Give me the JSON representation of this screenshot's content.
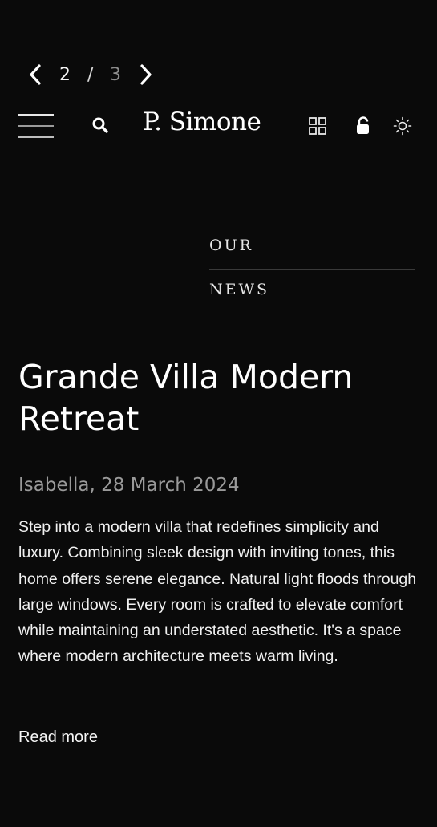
{
  "pager": {
    "current": "2",
    "separator": "/",
    "total": "3",
    "prev_icon": "chevron-left-icon",
    "next_icon": "chevron-right-icon"
  },
  "header": {
    "brand": "P. Simone",
    "icons": [
      "menu-icon",
      "search-icon",
      "grid-icon",
      "lock-icon",
      "sun-icon"
    ]
  },
  "section": {
    "line1": "OUR",
    "line2": "NEWS"
  },
  "article": {
    "title": "Grande Villa Modern Retreat",
    "meta": "Isabella, 28 March 2024",
    "body": "Step into a modern villa that redefines simplicity and luxury. Combining sleek design with inviting tones, this home offers serene elegance. Natural light floods through large windows. Every room is crafted to elevate comfort while maintaining an understated aesthetic. It's a space where modern architecture meets warm living.",
    "read_more": "Read more"
  },
  "colors": {
    "background": "#0a0a0a",
    "text": "#f2f2f2",
    "muted": "#9a9a9a"
  }
}
